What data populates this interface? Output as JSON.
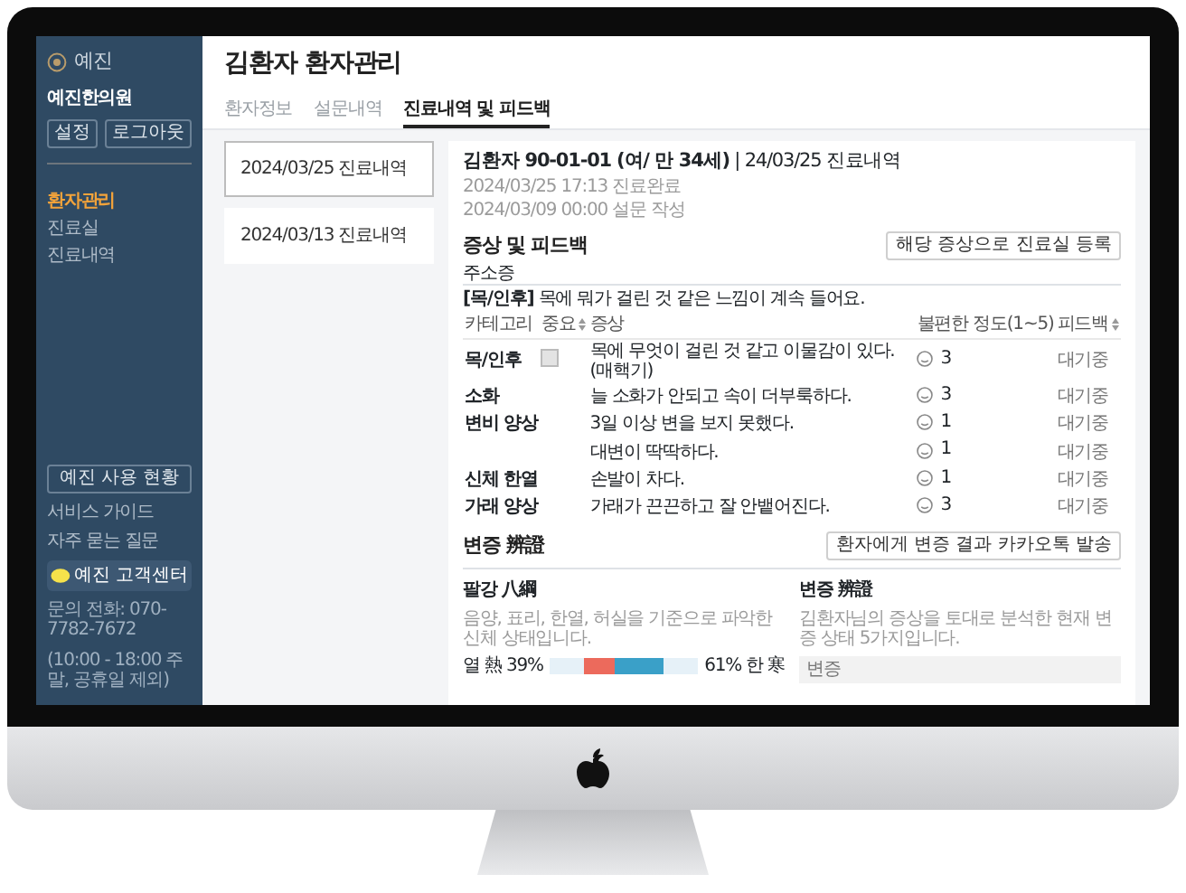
{
  "sidebar": {
    "logo": "예진",
    "clinic": "예진한의원",
    "buttons": [
      "설정",
      "로그아웃"
    ],
    "items": [
      {
        "label": "환자관리",
        "selected": true
      },
      {
        "label": "진료실",
        "selected": false
      },
      {
        "label": "진료내역",
        "selected": false
      }
    ],
    "usage_button": "예진 사용 현황",
    "links": [
      "서비스 가이드",
      "자주 묻는 질문"
    ],
    "support_button": "예진 고객센터",
    "contact": [
      "문의 전화: 070-7782-7672",
      "(10:00 - 18:00 주말, 공휴일 제외)"
    ]
  },
  "header": {
    "title": "김환자 환자관리",
    "tabs": [
      {
        "label": "환자정보",
        "selected": false
      },
      {
        "label": "설문내역",
        "selected": false
      },
      {
        "label": "진료내역 및 피드백",
        "selected": true
      }
    ]
  },
  "records": [
    {
      "label": "2024/03/25 진료내역",
      "selected": true
    },
    {
      "label": "2024/03/13 진료내역",
      "selected": false
    }
  ],
  "detail": {
    "title": "**김환자 90-01-01 (여/ 만 34세)** | 24/03/25 진료내역",
    "dates": [
      "2024/03/25 17:13 진료완료",
      "2024/03/09 00:00 설문 작성"
    ],
    "symptoms": {
      "title": "증상 및 피드백",
      "button": "해당 증상으로 진료실 등록",
      "chief_label": "주소증",
      "chief_complaint": "**[목/인후]** 목에 뭐가 걸린 것 같은 느낌이 계속 들어요.",
      "columns": [
        {
          "label": "카테고리",
          "sortable": false
        },
        {
          "label": "중요",
          "sortable": true
        },
        {
          "label": "증상",
          "sortable": false
        },
        {
          "label": "불편한 정도(1~5)",
          "sortable": false
        },
        {
          "label": "피드백",
          "sortable": true
        }
      ],
      "rows": [
        {
          "category": "목/인후",
          "important": true,
          "symptom": "목에 무엇이 걸린 것 같고 이물감이 있다.(매핵기)",
          "score": "3",
          "feedback": "대기중"
        },
        {
          "category": "소화",
          "important": false,
          "symptom": "늘 소화가 안되고 속이 더부룩하다.",
          "score": "3",
          "feedback": "대기중"
        },
        {
          "category": "변비 양상",
          "important": false,
          "symptom": "3일 이상 변을 보지 못했다.",
          "score": "1",
          "feedback": "대기중"
        },
        {
          "important": false,
          "symptom": "대변이 딱딱하다.",
          "score": "1",
          "feedback": "대기중"
        },
        {
          "category": "신체 한열",
          "important": false,
          "symptom": "손발이 차다.",
          "score": "1",
          "feedback": "대기중"
        },
        {
          "category": "가래 양상",
          "important": false,
          "symptom": "가래가 끈끈하고 잘 안뱉어진다.",
          "score": "3",
          "feedback": "대기중"
        }
      ]
    },
    "diagnosis": {
      "title": "변증 辨證",
      "button": "환자에게 변증 결과 카카오톡 발송",
      "panels": [
        {
          "kind": "balance",
          "title": "팔강 八綱",
          "description": "음양, 표리, 한열, 허실을 기준으로 파악한 신체 상태입니다.",
          "left_label": "열 熱 39%",
          "level": 0.39,
          "right_label": "61% 한 寒"
        },
        {
          "kind": "list",
          "title": "변증 辨證",
          "description": "김환자님의 증상을 토대로 분석한 현재 변증 상태 5가지입니다.",
          "field": "변증"
        }
      ]
    }
  }
}
